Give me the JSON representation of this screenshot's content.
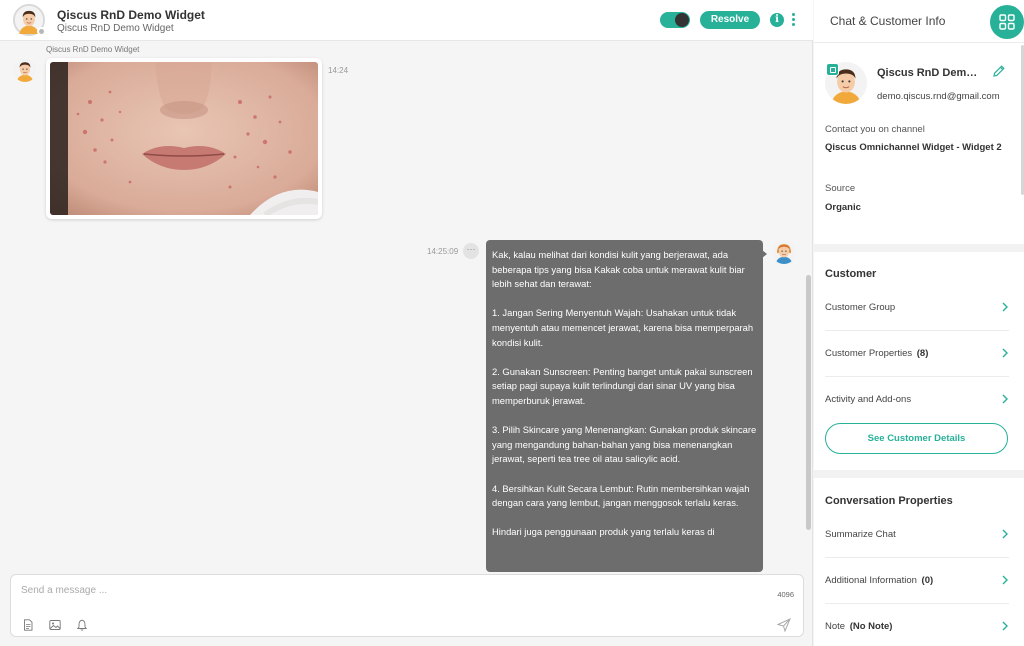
{
  "header": {
    "contact_name": "Qiscus RnD Demo Widget",
    "contact_subtitle": "Qiscus RnD Demo Widget",
    "resolve_label": "Resolve",
    "info_icon": "i"
  },
  "messages": {
    "incoming": {
      "sender": "Qiscus RnD Demo Widget",
      "time": "14:24"
    },
    "outgoing": {
      "time": "14:25:09",
      "options_glyph": "···",
      "text": "Kak, kalau melihat dari kondisi kulit yang berjerawat, ada beberapa tips yang bisa Kakak coba untuk merawat kulit biar lebih sehat dan terawat:\n\n1. Jangan Sering Menyentuh Wajah: Usahakan untuk tidak menyentuh atau memencet jerawat, karena bisa memperparah kondisi kulit.\n\n2. Gunakan Sunscreen: Penting banget untuk pakai sunscreen setiap pagi supaya kulit terlindungi dari sinar UV yang bisa memperburuk jerawat.\n\n3. Pilih Skincare yang Menenangkan: Gunakan produk skincare yang mengandung bahan-bahan yang bisa menenangkan jerawat, seperti tea tree oil atau salicylic acid.\n\n4. Bersihkan Kulit Secara Lembut: Rutin membersihkan wajah dengan cara yang lembut, jangan menggosok terlalu keras.\n\nHindari juga penggunaan produk yang terlalu keras di"
    }
  },
  "composer": {
    "placeholder": "Send a message ...",
    "char_limit": "4096"
  },
  "sidebar": {
    "title": "Chat & Customer Info",
    "profile": {
      "name": "Qiscus RnD Demo Widget",
      "email": "demo.qiscus.rnd@gmail.com",
      "contact_channel_label": "Contact you on channel",
      "contact_channel_value": "Qiscus Omnichannel Widget - Widget 2",
      "source_label": "Source",
      "source_value": "Organic"
    },
    "customer": {
      "title": "Customer",
      "items": [
        {
          "label": "Customer Group",
          "count": ""
        },
        {
          "label": "Customer Properties",
          "count": "(8)"
        },
        {
          "label": "Activity and Add-ons",
          "count": ""
        }
      ],
      "see_details_label": "See Customer Details"
    },
    "conversation": {
      "title": "Conversation Properties",
      "items": [
        {
          "label": "Summarize Chat",
          "count": ""
        },
        {
          "label": "Additional Information",
          "count": "(0)"
        },
        {
          "label": "Note",
          "count": "(No Note)"
        }
      ]
    }
  },
  "colors": {
    "accent": "#27b199",
    "bubble_bg": "#6d6d6d"
  }
}
